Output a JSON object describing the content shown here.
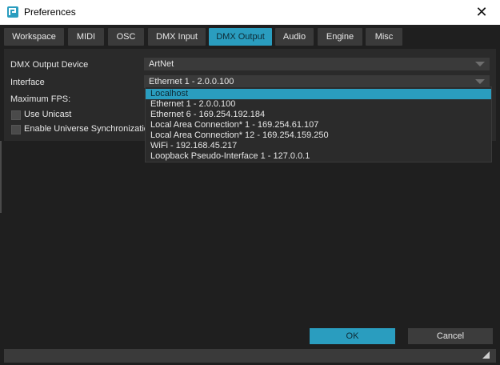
{
  "window": {
    "title": "Preferences"
  },
  "tabs": [
    {
      "label": "Workspace"
    },
    {
      "label": "MIDI"
    },
    {
      "label": "OSC"
    },
    {
      "label": "DMX Input"
    },
    {
      "label": "DMX Output",
      "active": true
    },
    {
      "label": "Audio"
    },
    {
      "label": "Engine"
    },
    {
      "label": "Misc"
    }
  ],
  "form": {
    "device_label": "DMX Output Device",
    "device_value": "ArtNet",
    "interface_label": "Interface",
    "interface_value": "Ethernet 1 - 2.0.0.100",
    "max_fps_label": "Maximum FPS:",
    "use_unicast_label": "Use Unicast",
    "universe_sync_label": "Enable Universe Synchronizatio"
  },
  "dropdown_options": [
    "Localhost",
    "Ethernet 1 - 2.0.0.100",
    "Ethernet 6 - 169.254.192.184",
    "Local Area Connection* 1 - 169.254.61.107",
    "Local Area Connection* 12 - 169.254.159.250",
    "WiFi - 192.168.45.217",
    "Loopback Pseudo-Interface 1 - 127.0.0.1"
  ],
  "buttons": {
    "ok": "OK",
    "cancel": "Cancel"
  },
  "colors": {
    "accent": "#2a9dbf",
    "background": "#1f1f1f",
    "panel": "#2a2a2a"
  }
}
